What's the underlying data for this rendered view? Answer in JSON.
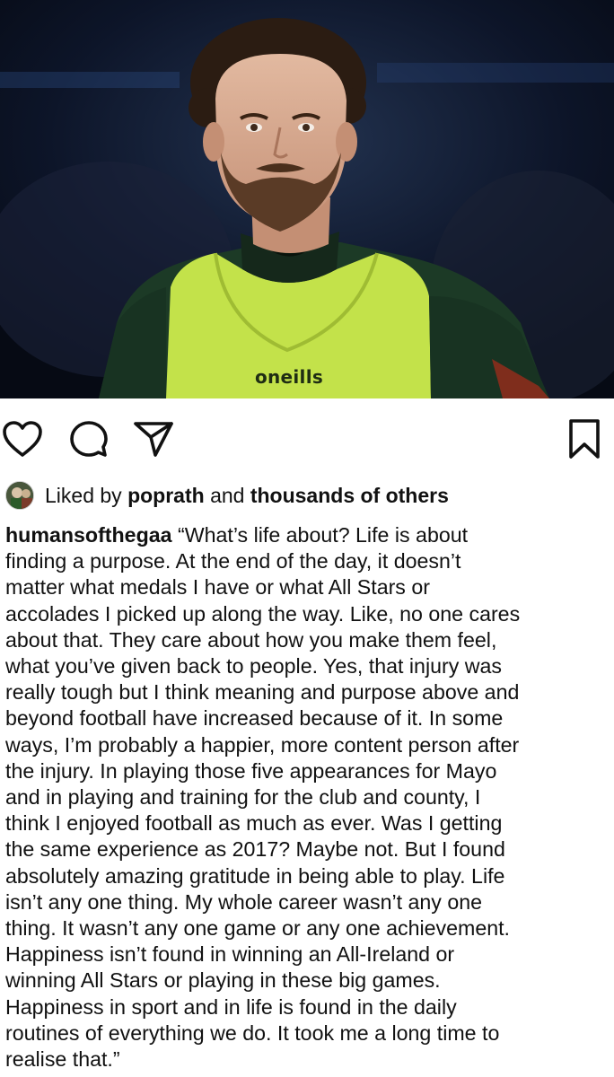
{
  "post": {
    "image_brand_text": "oneills"
  },
  "actions": {
    "like_icon": "heart-icon",
    "comment_icon": "comment-icon",
    "share_icon": "paper-plane-icon",
    "save_icon": "bookmark-icon"
  },
  "likes": {
    "prefix": "Liked by",
    "user": "poprath",
    "joiner": "and",
    "others": "thousands of others"
  },
  "caption": {
    "username": "humansofthegaa",
    "first_line_rest": " “What’s life about? Life is about",
    "lines": [
      "finding a purpose. At the end of the day, it doesn’t",
      "matter what medals I have or what All Stars or",
      "accolades I picked up along the way. Like, no one cares",
      "about that. They care about how you make them feel,",
      "what you’ve given back to people. Yes, that injury was",
      "really tough but I think meaning and purpose above and",
      "beyond football have increased because of it. In some",
      "ways, I’m probably a happier, more content person after",
      "the injury. In playing those five appearances for Mayo",
      "and in playing and training for the club and county, I",
      "think I enjoyed football as much as ever. Was I getting",
      "the same experience as 2017? Maybe not. But I found",
      "absolutely amazing gratitude in being able to play. Life",
      "isn’t any one thing. My whole career wasn’t any one",
      "thing. It wasn’t any one game or any one achievement.",
      "Happiness isn’t found in winning an All-Ireland or",
      "winning All Stars or playing in these big games.",
      "Happiness in sport and in life is found in the daily",
      "routines of everything we do. It took me a long time to",
      "realise that.”"
    ]
  }
}
